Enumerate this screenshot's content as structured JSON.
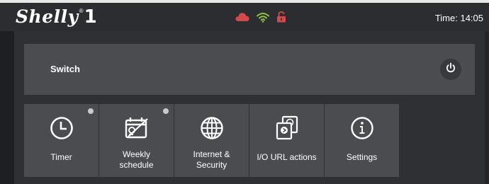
{
  "header": {
    "logo_word": "Shelly",
    "logo_reg": "®",
    "logo_number": "1",
    "time": "Time: 14:05",
    "icons": [
      "cloud-icon",
      "wifi-icon",
      "unlocked-icon"
    ],
    "icon_colors": {
      "cloud": "#d24a4a",
      "wifi": "#8ec63f",
      "lock": "#d24a4a"
    }
  },
  "switch": {
    "label": "Switch",
    "power_icon": "power-icon"
  },
  "tiles": [
    {
      "label": "Timer",
      "icon": "clock-icon",
      "has_indicator": true
    },
    {
      "label": "Weekly\nschedule",
      "icon": "schedule-icon",
      "has_indicator": true
    },
    {
      "label": "Internet &\nSecurity",
      "icon": "globe-icon",
      "has_indicator": false
    },
    {
      "label": "I/O URL actions",
      "icon": "url-actions-icon",
      "has_indicator": false
    },
    {
      "label": "Settings",
      "icon": "info-icon",
      "has_indicator": false
    }
  ]
}
